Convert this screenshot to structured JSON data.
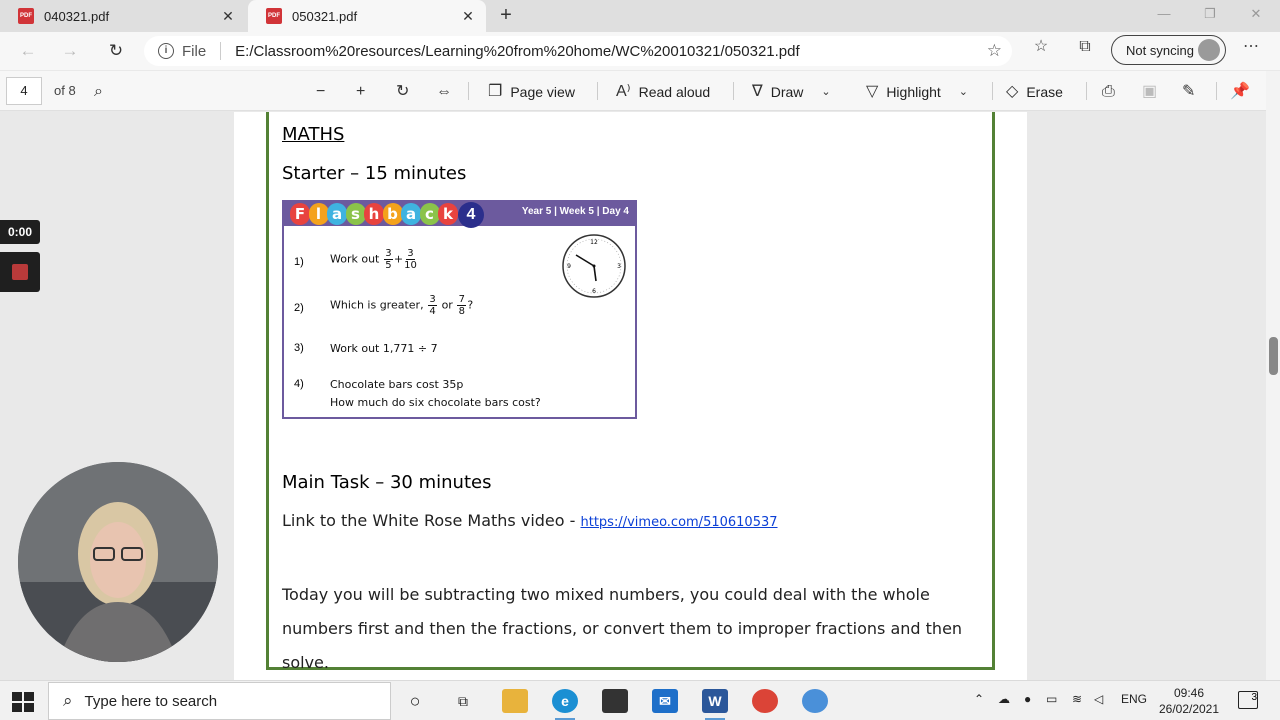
{
  "tabs": [
    {
      "title": "040321.pdf",
      "active": false
    },
    {
      "title": "050321.pdf",
      "active": true
    }
  ],
  "address": {
    "scheme_label": "File",
    "url": "E:/Classroom%20resources/Learning%20from%20home/WC%20010321/050321.pdf"
  },
  "profile": {
    "sync_label": "Not syncing"
  },
  "pdf_toolbar": {
    "page_number": "4",
    "page_count": "of 8",
    "page_view": "Page view",
    "read_aloud": "Read aloud",
    "draw": "Draw",
    "highlight": "Highlight",
    "erase": "Erase"
  },
  "document": {
    "heading": "MATHS",
    "starter_heading": "Starter – 15 minutes",
    "flashback": {
      "title_letters": [
        "F",
        "l",
        "a",
        "s",
        "h",
        "b",
        "a",
        "c",
        "k"
      ],
      "letter_colors": [
        "#e8433f",
        "#f4a21c",
        "#3fb3e0",
        "#8bc34a",
        "#e8433f",
        "#f4a21c",
        "#3fb3e0",
        "#8bc34a",
        "#e8433f"
      ],
      "number": "4",
      "meta": "Year 5 | Week 5 | Day 4",
      "q1_num": "1)",
      "q1_text": "Work out",
      "q1_a_num": "3",
      "q1_a_den": "5",
      "q1_op": "+",
      "q1_b_num": "3",
      "q1_b_den": "10",
      "q2_num": "2)",
      "q2_text": "Which is greater,",
      "q2_a_num": "3",
      "q2_a_den": "4",
      "q2_or": "or",
      "q2_b_num": "7",
      "q2_b_den": "8",
      "q2_end": "?",
      "q3_num": "3)",
      "q3_text": "Work out 1,771 ÷ 7",
      "q4_num": "4)",
      "q4_text": "Chocolate bars cost 35p",
      "q4_text2": "How much do six chocolate bars cost?"
    },
    "main_heading": "Main Task – 30 minutes",
    "link_prefix": "Link to the White Rose Maths video - ",
    "link_url": "https://vimeo.com/510610537",
    "paragraph": "Today you will be subtracting two mixed numbers, you could deal with the whole numbers first and then the fractions, or convert them to improper fractions and then solve."
  },
  "recorder": {
    "timer": "0:00"
  },
  "taskbar": {
    "search_placeholder": "Type here to search",
    "language": "ENG",
    "time": "09:46",
    "date": "26/02/2021",
    "notifications": "3"
  },
  "colors": {
    "frame_green": "#538135",
    "flashback_purple": "#6c5a9e",
    "link_blue": "#0b3fd6"
  }
}
